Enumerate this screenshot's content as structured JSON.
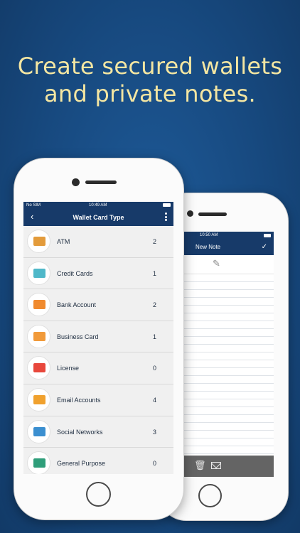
{
  "headline": {
    "line1": "Create secured wallets",
    "line2": "and private notes."
  },
  "front_phone": {
    "status": {
      "carrier": "No SIM",
      "time": "10:49 AM"
    },
    "nav": {
      "title": "Wallet Card Type"
    },
    "items": [
      {
        "label": "ATM",
        "count": "2",
        "icon": "atm-card-icon",
        "color": "#e39b3b"
      },
      {
        "label": "Credit Cards",
        "count": "1",
        "icon": "credit-card-icon",
        "color": "#4fb8c9"
      },
      {
        "label": "Bank Account",
        "count": "2",
        "icon": "piggy-bank-icon",
        "color": "#f08a2e"
      },
      {
        "label": "Business Card",
        "count": "1",
        "icon": "business-card-icon",
        "color": "#f19a3a"
      },
      {
        "label": "License",
        "count": "0",
        "icon": "license-icon",
        "color": "#e8473c"
      },
      {
        "label": "Email Accounts",
        "count": "4",
        "icon": "envelope-icon",
        "color": "#f0a12e"
      },
      {
        "label": "Social Networks",
        "count": "3",
        "icon": "social-network-icon",
        "color": "#3b8fd0"
      },
      {
        "label": "General Purpose",
        "count": "0",
        "icon": "general-purpose-icon",
        "color": "#2f9e7a"
      }
    ]
  },
  "back_phone": {
    "status": {
      "time": "10:50 AM"
    },
    "nav": {
      "title": "New Note"
    }
  }
}
